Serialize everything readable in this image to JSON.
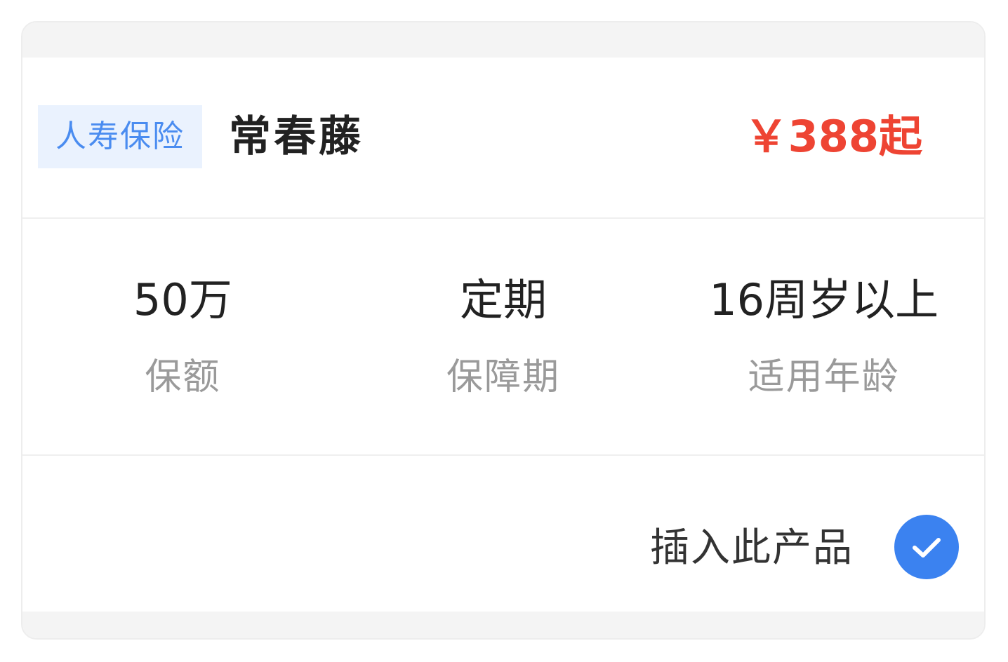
{
  "product": {
    "category_tag": "人寿保险",
    "name": "常春藤",
    "price": "￥388起"
  },
  "attributes": [
    {
      "value": "50万",
      "label": "保额"
    },
    {
      "value": "定期",
      "label": "保障期"
    },
    {
      "value": "16周岁以上",
      "label": "适用年龄"
    }
  ],
  "footer": {
    "insert_label": "插入此产品",
    "selected": true,
    "check_icon": "checkmark-icon"
  },
  "colors": {
    "accent_blue": "#3b82f0",
    "tag_text": "#4a8cf0",
    "tag_bg": "#eaf2fe",
    "price_red": "#ee4433"
  }
}
